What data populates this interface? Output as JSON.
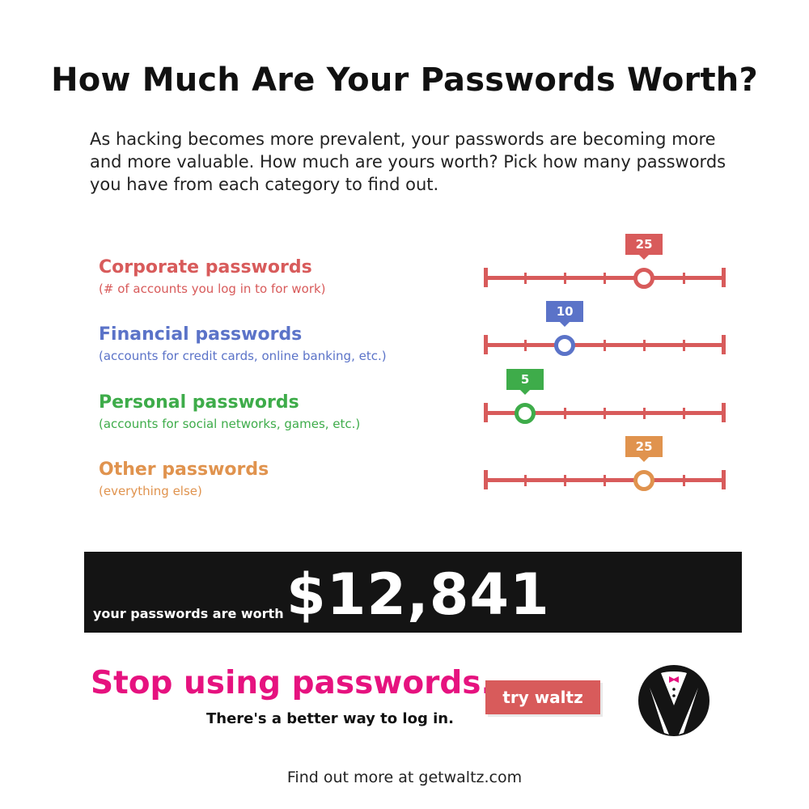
{
  "header": {
    "title": "How Much Are Your Passwords Worth?",
    "intro": "As hacking becomes more prevalent, your passwords are becoming more and more valuable. How much are yours worth? Pick how many passwords you have from each category to find out."
  },
  "categories": [
    {
      "title": "Corporate passwords",
      "subtitle": "(# of accounts you log in to for work)",
      "value": 25,
      "value_label": "25",
      "color": "#d85b5b",
      "fraction": 0.667
    },
    {
      "title": "Financial passwords",
      "subtitle": "(accounts for credit cards, online banking, etc.)",
      "value": 10,
      "value_label": "10",
      "color": "#5b73c8",
      "fraction": 0.334
    },
    {
      "title": "Personal passwords",
      "subtitle": "(accounts for social networks, games, etc.)",
      "value": 5,
      "value_label": "5",
      "color": "#3eac4a",
      "fraction": 0.167
    },
    {
      "title": "Other passwords",
      "subtitle": "(everything else)",
      "value": 25,
      "value_label": "25",
      "color": "#e0934e",
      "fraction": 0.667
    }
  ],
  "slider_track_color": "#d85b5b",
  "result": {
    "label": "your passwords are worth",
    "amount": "$12,841"
  },
  "cta": {
    "headline": "Stop using passwords.",
    "subline": "There's a better way to log in.",
    "button_label": "try waltz",
    "logo_icon": "tuxedo-icon"
  },
  "footer": {
    "text": "Find out more at getwaltz.com"
  }
}
